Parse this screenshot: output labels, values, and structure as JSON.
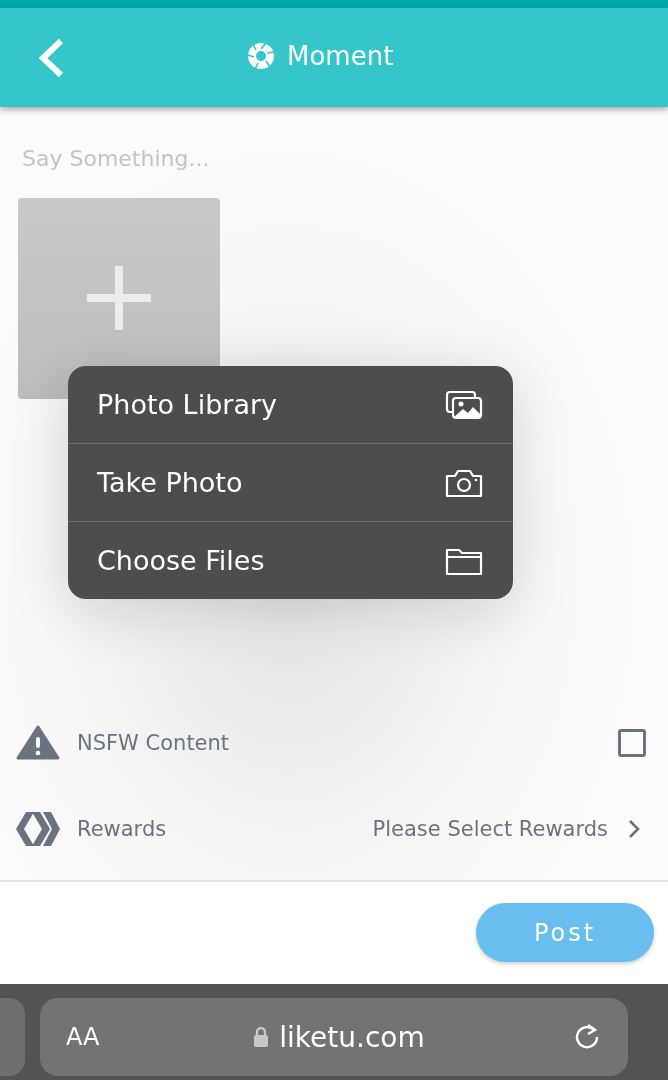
{
  "header": {
    "title": "Moment"
  },
  "composer": {
    "placeholder": "Say Something..."
  },
  "upload_menu": [
    {
      "label": "Photo Library",
      "kind": "photos"
    },
    {
      "label": "Take Photo",
      "kind": "camera"
    },
    {
      "label": "Choose Files",
      "kind": "folder"
    }
  ],
  "options": [
    {
      "kind": "checkbox",
      "label": "NSFW Content",
      "checked": false
    },
    {
      "kind": "select",
      "label": "Rewards",
      "value": "Please Select Rewards"
    }
  ],
  "post_button": "Post",
  "browser": {
    "text_size": "AA",
    "url": "liketu.com"
  }
}
